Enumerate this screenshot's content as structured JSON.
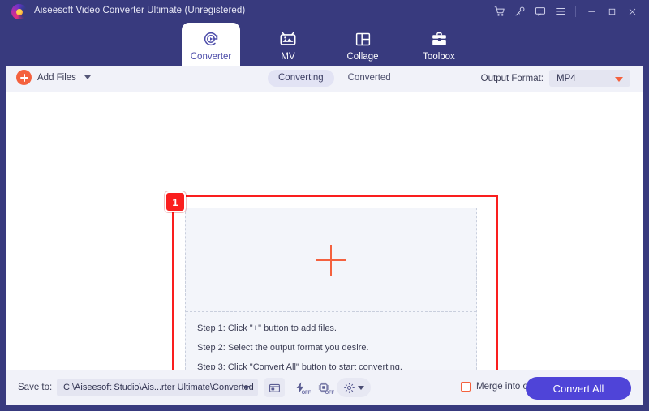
{
  "window": {
    "title": "Aiseesoft Video Converter Ultimate (Unregistered)",
    "logo_icon": "aiseesoft-logo-icon",
    "controls": [
      {
        "name": "cart-icon",
        "tip": "Cart"
      },
      {
        "name": "key-icon",
        "tip": "Register"
      },
      {
        "name": "feedback-icon",
        "tip": "Feedback"
      },
      {
        "name": "menu-icon",
        "tip": "Menu"
      },
      {
        "name": "minimize-icon",
        "tip": "Minimize"
      },
      {
        "name": "maximize-icon",
        "tip": "Maximize"
      },
      {
        "name": "close-icon",
        "tip": "Close"
      }
    ]
  },
  "tabs": [
    {
      "id": "converter",
      "label": "Converter",
      "icon": "converter-icon",
      "active": true
    },
    {
      "id": "mv",
      "label": "MV",
      "icon": "mv-icon",
      "active": false
    },
    {
      "id": "collage",
      "label": "Collage",
      "icon": "collage-icon",
      "active": false
    },
    {
      "id": "toolbox",
      "label": "Toolbox",
      "icon": "toolbox-icon",
      "active": false
    }
  ],
  "toolbar": {
    "add_files_label": "Add Files",
    "add_files_icon": "plus-circle-icon",
    "add_files_caret": "chevron-down-icon",
    "segments": [
      {
        "label": "Converting",
        "active": true
      },
      {
        "label": "Converted",
        "active": false
      }
    ],
    "output_format_label": "Output Format:",
    "output_format_value": "MP4"
  },
  "dropzone": {
    "plus_icon": "plus-icon",
    "steps": [
      "Step 1: Click \"+\" button to add files.",
      "Step 2: Select the output format you desire.",
      "Step 3: Click \"Convert All\" button to start converting."
    ]
  },
  "annotation": {
    "badge_number": "1",
    "color": "#fa1e1e"
  },
  "bottom": {
    "save_to_label": "Save to:",
    "save_to_path": "C:\\Aiseesoft Studio\\Ais...rter Ultimate\\Converted",
    "buttons": [
      {
        "name": "open-folder-icon",
        "label": ""
      },
      {
        "name": "hardware-acceleration-icon",
        "label": "OFF"
      },
      {
        "name": "gpu-acceleration-icon",
        "label": "OFF"
      },
      {
        "name": "preferences-gear-icon",
        "label": ""
      }
    ],
    "merge_label": "Merge into one file",
    "merge_checked": false,
    "convert_all_label": "Convert All"
  },
  "colors": {
    "header": "#383a7e",
    "accent_orange": "#f4613e",
    "accent_purple": "#4f44d8",
    "annotation_red": "#fa1e1e",
    "panel_grey": "#f1f2f9",
    "dropzone": "#f3f5fa"
  }
}
